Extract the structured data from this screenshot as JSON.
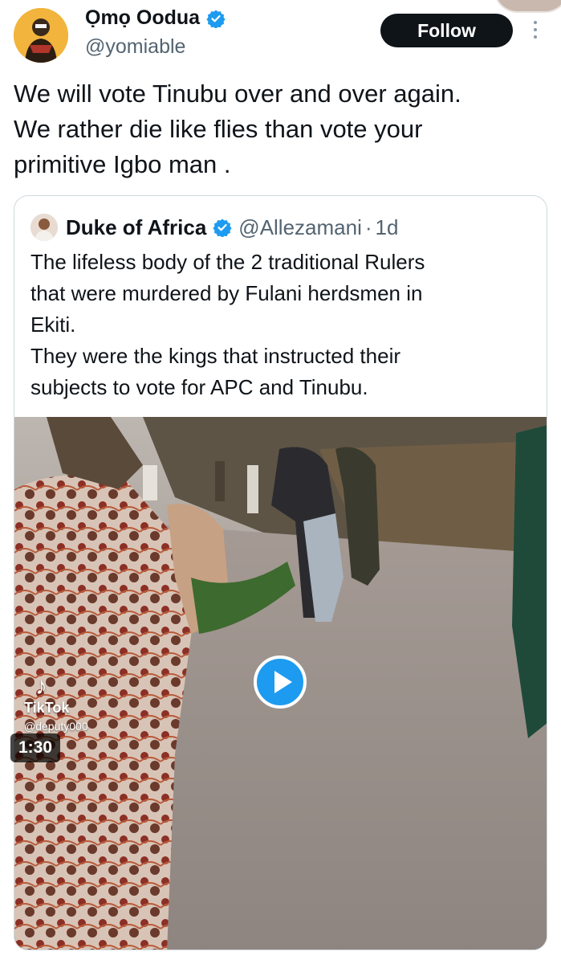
{
  "tweet": {
    "author_name": "Ọmọ Oodua",
    "author_handle": "@yomiable",
    "follow_label": "Follow",
    "text": "We will vote Tinubu over and over again.\nWe rather die like flies than vote your\nprimitive Igbo man ."
  },
  "quoted": {
    "author_name": "Duke of Africa",
    "author_handle": "@Allezamani",
    "separator": "·",
    "time": "1d",
    "text": "The lifeless body of the 2 traditional Rulers\nthat were murdered by Fulani herdsmen in\nEkiti.\nThey were the kings that instructed their\nsubjects to vote for APC and Tinubu."
  },
  "video": {
    "duration": "1:30",
    "watermark_brand": "TikTok",
    "watermark_user": "@deputy000"
  },
  "colors": {
    "verified": "#1d9bf0",
    "follow_bg": "#0f1419",
    "secondary_text": "#536471",
    "border": "#cfd9de"
  },
  "icons": [
    "verified-badge-icon",
    "more-options-icon",
    "play-icon",
    "tiktok-icon"
  ]
}
